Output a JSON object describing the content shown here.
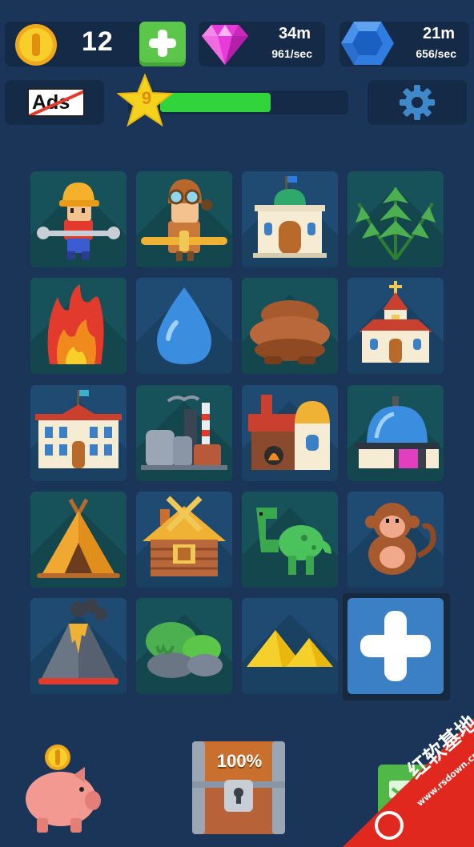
{
  "currencies": {
    "coins": {
      "value": "12",
      "icon": "gold-coin-icon"
    },
    "gems": {
      "amount": "34m",
      "rate": "961/sec",
      "icon": "pink-diamond-icon",
      "color": "#e63bd8"
    },
    "sapphires": {
      "amount": "21m",
      "rate": "656/sec",
      "icon": "blue-sapphire-icon",
      "color": "#2f7de0"
    }
  },
  "ads_button": {
    "label": "Ads",
    "icon": "no-ads-icon"
  },
  "level": {
    "number": "9",
    "progress": 0.6
  },
  "settings": {
    "icon": "gear-icon"
  },
  "grid": {
    "tiles": [
      {
        "name": "builder",
        "icon": "builder-worker-icon",
        "bg": "teal"
      },
      {
        "name": "pilot",
        "icon": "pilot-aviator-icon",
        "bg": "teal"
      },
      {
        "name": "museum",
        "icon": "museum-building-icon",
        "bg": "blue"
      },
      {
        "name": "fern",
        "icon": "fern-plant-icon",
        "bg": "teal"
      },
      {
        "name": "fire",
        "icon": "fire-icon",
        "bg": "teal"
      },
      {
        "name": "water",
        "icon": "water-drop-icon",
        "bg": "blue"
      },
      {
        "name": "mud",
        "icon": "mud-pile-icon",
        "bg": "teal"
      },
      {
        "name": "church",
        "icon": "church-icon",
        "bg": "blue"
      },
      {
        "name": "school",
        "icon": "school-building-icon",
        "bg": "blue"
      },
      {
        "name": "factory",
        "icon": "factory-icon",
        "bg": "teal"
      },
      {
        "name": "forge",
        "icon": "forge-workshop-icon",
        "bg": "blue"
      },
      {
        "name": "observatory",
        "icon": "observatory-icon",
        "bg": "teal"
      },
      {
        "name": "tipi",
        "icon": "tipi-tent-icon",
        "bg": "teal"
      },
      {
        "name": "cabin",
        "icon": "log-cabin-icon",
        "bg": "blue"
      },
      {
        "name": "dinosaur",
        "icon": "dinosaur-icon",
        "bg": "teal"
      },
      {
        "name": "monkey",
        "icon": "monkey-icon",
        "bg": "blue"
      },
      {
        "name": "volcano",
        "icon": "volcano-icon",
        "bg": "blue"
      },
      {
        "name": "swamp",
        "icon": "swamp-rocks-icon",
        "bg": "teal"
      },
      {
        "name": "sand",
        "icon": "sand-dunes-icon",
        "bg": "blue"
      }
    ],
    "add_tile": {
      "icon": "plus-icon"
    }
  },
  "bottom": {
    "piggy_bank": {
      "icon": "piggy-bank-icon"
    },
    "chest": {
      "label": "100%",
      "icon": "treasure-chest-icon"
    },
    "side_button": {
      "icon": "green-side-button-icon"
    }
  },
  "watermark": {
    "text": "红软基地",
    "url": "www.rsdown.cn"
  }
}
